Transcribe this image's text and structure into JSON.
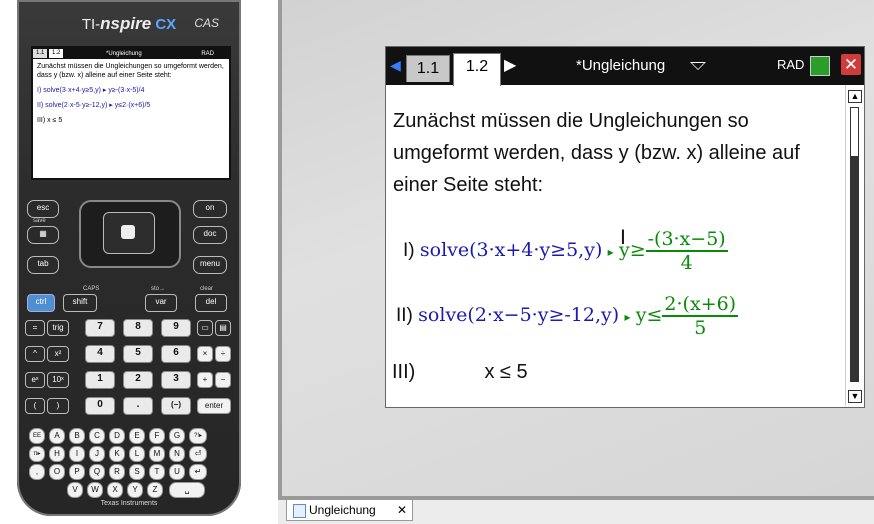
{
  "handheld": {
    "brand_ti": "TI-",
    "brand_spire": "nspire",
    "brand_cx": "CX",
    "brand_cas": "CAS",
    "screen": {
      "tabs": [
        "1.1",
        "1.2"
      ],
      "title": "*Ungleichung",
      "rad": "RAD",
      "intro": "Zunächst müssen die Ungleichungen so umgeformt werden, dass y (bzw. x) alleine auf einer Seite steht:",
      "line1": "I) solve(3·x+4·y≥5,y) ▸ y≥-(3·x-5)/4",
      "line2": "II) solve(2·x-5·y≥-12,y) ▸ y≤2·(x+6)/5",
      "line3": "III)         x ≤ 5"
    },
    "keys": {
      "esc": "esc",
      "save": "save",
      "tab": "tab",
      "on": "on",
      "doc": "doc",
      "menu": "menu",
      "ctrl": "ctrl",
      "shift": "shift",
      "var": "var",
      "del": "del",
      "eq": "=",
      "trig": "trig",
      "caps": "CAPS",
      "sto": "sto→",
      "clear": "clear",
      "n7": "7",
      "n8": "8",
      "n9": "9",
      "n4": "4",
      "n5": "5",
      "n6": "6",
      "n1": "1",
      "n2": "2",
      "n3": "3",
      "n0": "0",
      "dot": ".",
      "neg": "(−)",
      "enter": "enter",
      "pow": "^",
      "sq": "x²",
      "ex": "eˣ",
      "ten": "10ˣ",
      "lp": "(",
      "rp": ")",
      "mul": "×",
      "div": "÷",
      "add": "+",
      "sub": "−",
      "letters_row1": [
        "EE",
        "A",
        "B",
        "C",
        "D",
        "E",
        "F",
        "G",
        "?!▸"
      ],
      "letters_row2": [
        "π▸",
        "H",
        "I",
        "J",
        "K",
        "L",
        "M",
        "N",
        "⏎"
      ],
      "letters_row3": [
        ",",
        "O",
        "P",
        "Q",
        "R",
        "S",
        "T",
        "U",
        "↵"
      ],
      "letters_row4": [
        "V",
        "W",
        "X",
        "Y",
        "Z",
        "␣"
      ]
    },
    "ti_logo": "Texas Instruments"
  },
  "document": {
    "tabs": [
      "1.1",
      "1.2"
    ],
    "active_tab": "1.2",
    "title": "*Ungleichung",
    "angle_mode": "RAD",
    "close_symbol": "✕",
    "intro": "Zunächst müssen die Ungleichungen so umgeformt werden, dass y (bzw. x) alleine auf einer Seite steht:",
    "eq1": {
      "label": "I)",
      "command": "solve(3·x+4·y≥5,y)",
      "arrow": "▸",
      "result_lhs": "y≥",
      "numerator": "-(3·x−5)",
      "denominator": "4"
    },
    "eq2": {
      "label": "II)",
      "command": "solve(2·x−5·y≥-12,y)",
      "arrow": "▸",
      "result_lhs": "y≤",
      "numerator": "2·(x+6)",
      "denominator": "5"
    },
    "eq3": {
      "label": "III)",
      "expr": "x ≤ 5"
    }
  },
  "bottom_tab": {
    "label": "Ungleichung",
    "close": "✕"
  },
  "colors": {
    "cmd_blue": "#1a1ab0",
    "result_green": "#0a8a0a",
    "close_red": "#d03b3b",
    "arrow_blue": "#3a7bff"
  }
}
